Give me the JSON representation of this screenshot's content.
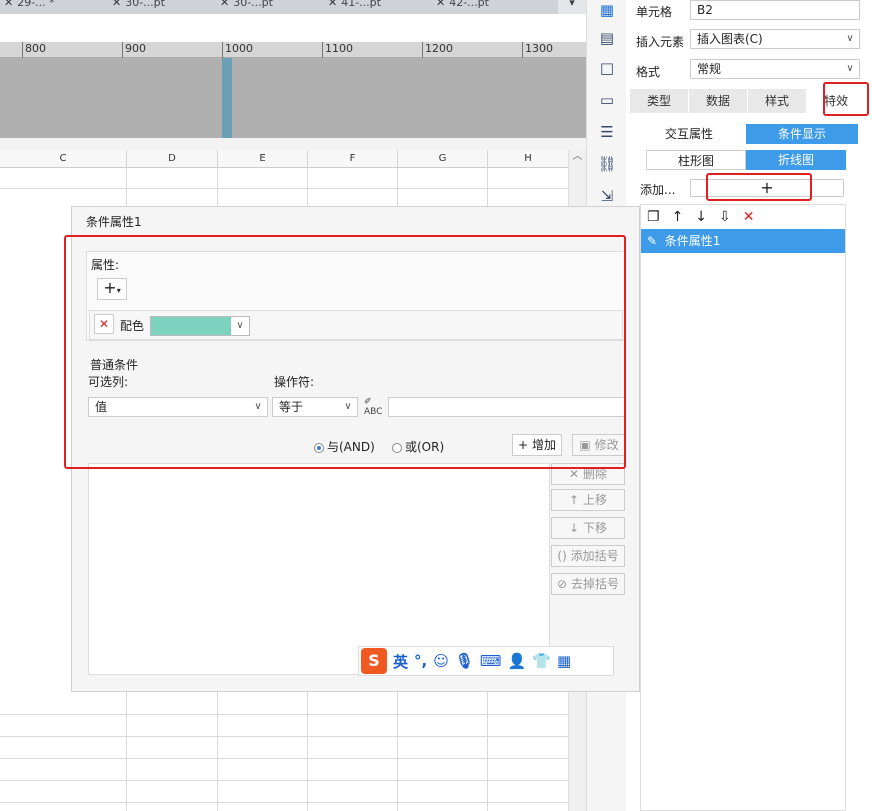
{
  "file_tabs": [
    "29-...  *",
    "30-...pt",
    "30-...pt",
    "41-...pt",
    "42-...pt"
  ],
  "ruler_marks": [
    "800",
    "900",
    "1000",
    "1100",
    "1200",
    "1300"
  ],
  "columns": [
    "C",
    "D",
    "E",
    "F",
    "G",
    "H"
  ],
  "panel": {
    "cell_label": "单元格",
    "cell_value": "B2",
    "insert_label": "插入元素",
    "insert_value": "插入图表(C)",
    "format_label": "格式",
    "format_value": "常规",
    "tabs": [
      "类型",
      "数据",
      "样式",
      "特效"
    ],
    "subtabs": [
      "交互属性",
      "条件显示"
    ],
    "chart_types": [
      "柱形图",
      "折线图"
    ],
    "add_label": "添加...",
    "add_button": "+",
    "list_item": "条件属性1"
  },
  "dialog": {
    "title": "条件属性1",
    "attr_label": "属性:",
    "add_attr": "+",
    "color_label": "配色",
    "color_value": "#7dd3c0",
    "section_label": "普通条件",
    "col_label": "可选列:",
    "op_label": "操作符:",
    "col_value": "值",
    "op_value": "等于",
    "radio_and": "与(AND)",
    "radio_or": "或(OR)",
    "btn_add": "增加",
    "btn_modify": "修改",
    "btn_delete": "删除",
    "btn_up": "上移",
    "btn_down": "下移",
    "btn_add_bracket": "添加括号",
    "btn_remove_bracket": "去掉括号"
  },
  "ime": {
    "logo": "S",
    "mode": "英"
  }
}
